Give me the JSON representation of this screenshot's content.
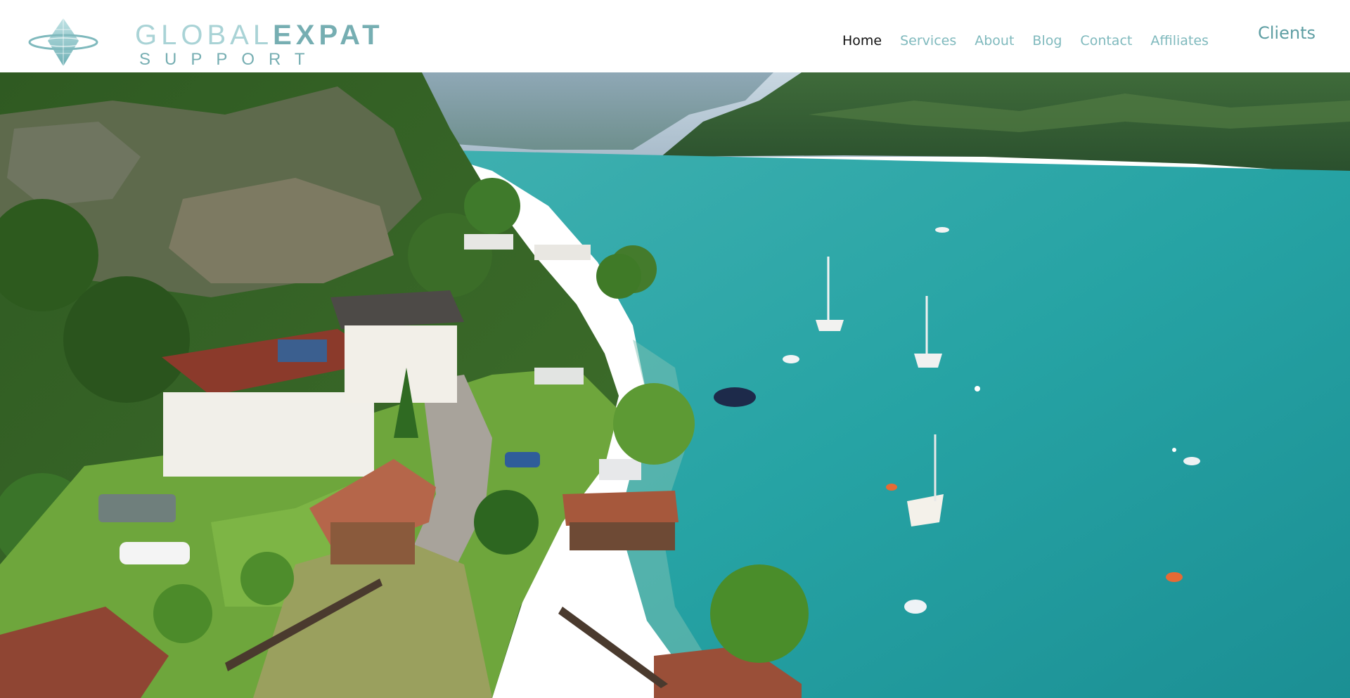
{
  "logo": {
    "word1": "GLOBAL",
    "word2": "EXPAT",
    "word3": "SUPPORT",
    "icon": "diamond-globe-logo"
  },
  "nav": {
    "items": [
      {
        "label": "Home",
        "active": true
      },
      {
        "label": "Services",
        "active": false
      },
      {
        "label": "About",
        "active": false
      },
      {
        "label": "Blog",
        "active": false
      },
      {
        "label": "Contact",
        "active": false
      },
      {
        "label": "Affiliates",
        "active": false
      }
    ]
  },
  "clients_label": "Clients",
  "hero": {
    "type": "photo",
    "subject": "aerial-lake-village"
  },
  "colors": {
    "brand_dark": "#76aeb2",
    "brand_light": "#a9d3d6",
    "nav_text": "#7fb9bd",
    "nav_active": "#111111",
    "lake": "#2aa5a5"
  }
}
